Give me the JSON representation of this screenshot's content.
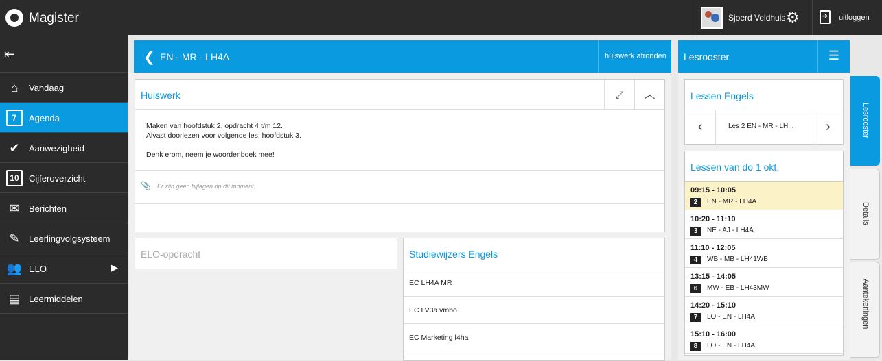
{
  "app": {
    "title": "Magister"
  },
  "topbar": {
    "user_name": "Sjoerd Veldhuis",
    "logout_label": "uitloggen"
  },
  "sidebar": {
    "items": [
      {
        "label": "Vandaag",
        "icon": "home-icon"
      },
      {
        "label": "Agenda",
        "icon": "calendar-icon",
        "badge": "7"
      },
      {
        "label": "Aanwezigheid",
        "icon": "check-circle-icon"
      },
      {
        "label": "Cijferoverzicht",
        "icon": "grade-icon",
        "badge": "10"
      },
      {
        "label": "Berichten",
        "icon": "envelope-icon"
      },
      {
        "label": "Leerlingvolgsysteem",
        "icon": "notebook-icon"
      },
      {
        "label": "ELO",
        "icon": "people-icon"
      },
      {
        "label": "Leermiddelen",
        "icon": "books-icon"
      }
    ]
  },
  "main": {
    "header_title": "EN - MR - LH4A",
    "finish_label": "huiswerk afronden",
    "homework": {
      "title": "Huiswerk",
      "line1": "Maken van hoofdstuk 2, opdracht 4 t/m 12.",
      "line2": "Alvast doorlezen voor volgende les: hoofdstuk 3.",
      "line3": "Denk erom, neem je woordenboek mee!",
      "attachments_empty": "Er zijn geen bijlagen op dit moment."
    },
    "elo_title": "ELO-opdracht",
    "studiewijzers": {
      "title": "Studiewijzers Engels",
      "items": [
        "EC LH4A MR",
        "EC LV3a vmbo",
        "EC Marketing l4ha"
      ]
    }
  },
  "right": {
    "header_title": "Lesrooster",
    "lessen_title": "Lessen Engels",
    "current_lesson": "Les 2 EN - MR - LH...",
    "day_title": "Lessen van do 1 okt.",
    "lessons": [
      {
        "time": "09:15 - 10:05",
        "num": "2",
        "code": "EN - MR - LH4A"
      },
      {
        "time": "10:20 - 11:10",
        "num": "3",
        "code": "NE - AJ - LH4A"
      },
      {
        "time": "11:10 - 12:05",
        "num": "4",
        "code": "WB - MB - LH41WB"
      },
      {
        "time": "13:15 - 14:05",
        "num": "6",
        "code": "MW - EB - LH43MW"
      },
      {
        "time": "14:20 - 15:10",
        "num": "7",
        "code": "LO - EN - LH4A"
      },
      {
        "time": "15:10 - 16:00",
        "num": "8",
        "code": "LO - EN - LH4A"
      }
    ]
  },
  "tabs": [
    "Lesrooster",
    "Details",
    "Aantekeningen"
  ],
  "colors": {
    "accent": "#0a9ae0",
    "topbar": "#2b2b2b",
    "highlight": "#fcf2c8"
  }
}
